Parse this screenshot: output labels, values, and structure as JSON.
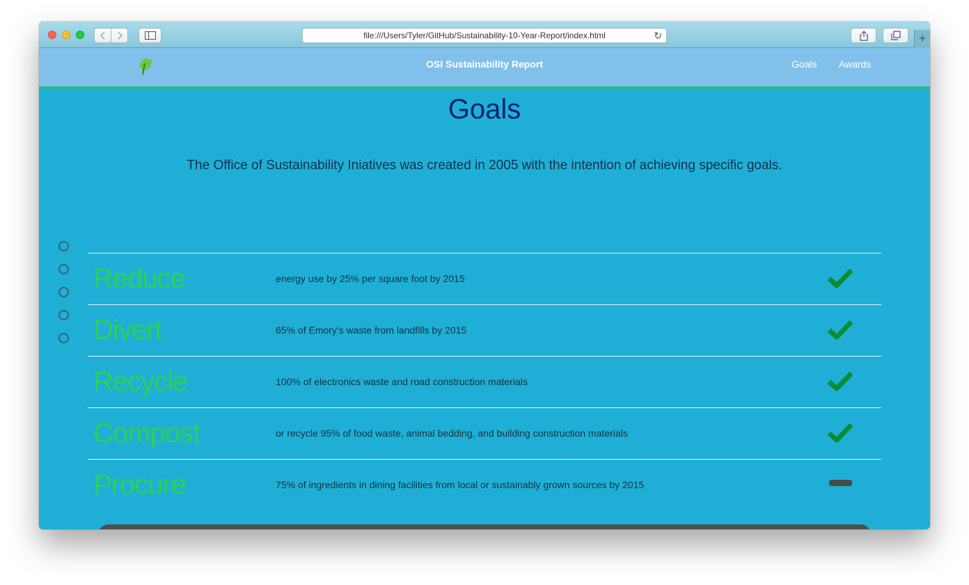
{
  "browser": {
    "url": "file:///Users/Tyler/GitHub/Sustainability-10-Year-Report/index.html",
    "add_tab_label": "+"
  },
  "navbar": {
    "title": "OSI Sustainability Report",
    "links": [
      "Goals",
      "Awards"
    ]
  },
  "main": {
    "heading": "Goals",
    "intro": "The Office of Sustainability Iniatives was created in 2005 with the intention of achieving specific goals."
  },
  "goals": [
    {
      "verb": "Reduce",
      "description": "energy use by 25% per square foot by 2015",
      "status": "check-icon"
    },
    {
      "verb": "Divert",
      "description": "65% of Emory's waste from landfills by 2015",
      "status": "check-icon"
    },
    {
      "verb": "Recycle",
      "description": "100% of electronics waste and road construction materials",
      "status": "check-icon"
    },
    {
      "verb": "Compost",
      "description": "or recycle 95% of food waste, animal bedding, and building construction materials",
      "status": "check-icon"
    },
    {
      "verb": "Procure",
      "description": "75% of ingredients in dining facilities from local or sustainably grown sources by 2015",
      "status": "dash-icon"
    }
  ],
  "colors": {
    "page_background": "#1fafd6",
    "navbar": "#81c0ea",
    "heading": "#0d2272",
    "goal_verb": "#2fcf56",
    "check": "#0a8c31"
  },
  "section_dots_count": 5
}
